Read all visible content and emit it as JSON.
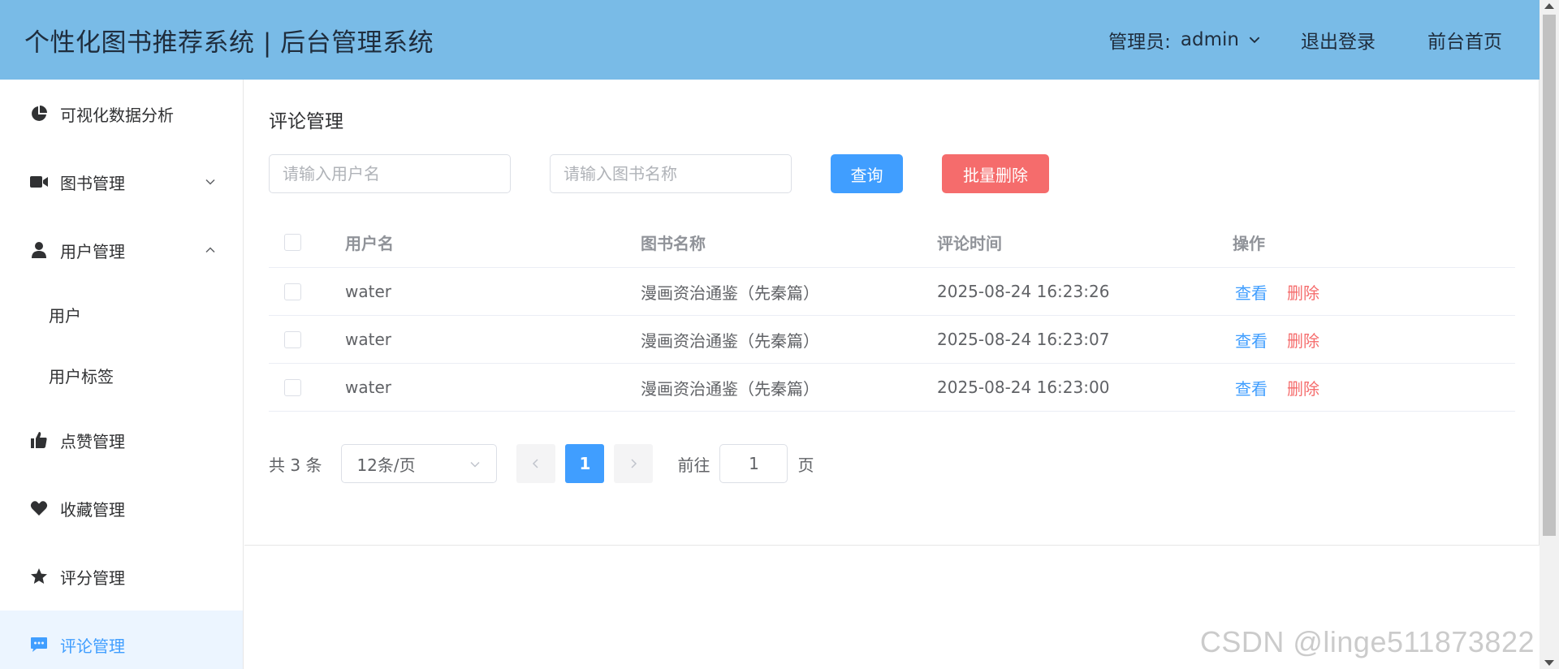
{
  "header": {
    "title": "个性化图书推荐系统 | 后台管理系统",
    "admin_label": "管理员:",
    "admin_name": "admin",
    "logout": "退出登录",
    "home": "前台首页",
    "bg_color": "#79bbe7"
  },
  "sidebar": {
    "items": [
      {
        "label": "可视化数据分析",
        "icon": "pie-chart-icon"
      },
      {
        "label": "图书管理",
        "icon": "video-camera-icon",
        "expanded": false
      },
      {
        "label": "用户管理",
        "icon": "user-icon",
        "expanded": true
      },
      {
        "label": "点赞管理",
        "icon": "thumbs-up-icon"
      },
      {
        "label": "收藏管理",
        "icon": "heart-icon"
      },
      {
        "label": "评分管理",
        "icon": "star-icon"
      },
      {
        "label": "评论管理",
        "icon": "chat-icon",
        "active": true
      }
    ],
    "sub_items": [
      "用户",
      "用户标签"
    ],
    "active_color": "#409eff"
  },
  "main": {
    "title": "评论管理",
    "search": {
      "username_placeholder": "请输入用户名",
      "book_placeholder": "请输入图书名称",
      "query_label": "查询",
      "batch_delete_label": "批量删除"
    },
    "table": {
      "headers": [
        "用户名",
        "图书名称",
        "评论时间",
        "操作"
      ],
      "rows": [
        {
          "user": "water",
          "book": "漫画资治通鉴（先秦篇）",
          "time": "2025-08-24 16:23:26"
        },
        {
          "user": "water",
          "book": "漫画资治通鉴（先秦篇）",
          "time": "2025-08-24 16:23:07"
        },
        {
          "user": "water",
          "book": "漫画资治通鉴（先秦篇）",
          "time": "2025-08-24 16:23:00"
        }
      ],
      "view_label": "查看",
      "delete_label": "删除"
    },
    "pagination": {
      "total_text": "共 3 条",
      "page_size": "12条/页",
      "current_page": "1",
      "goto_label": "前往",
      "goto_value": "1",
      "page_unit": "页"
    }
  },
  "watermark": "CSDN @linge511873822"
}
